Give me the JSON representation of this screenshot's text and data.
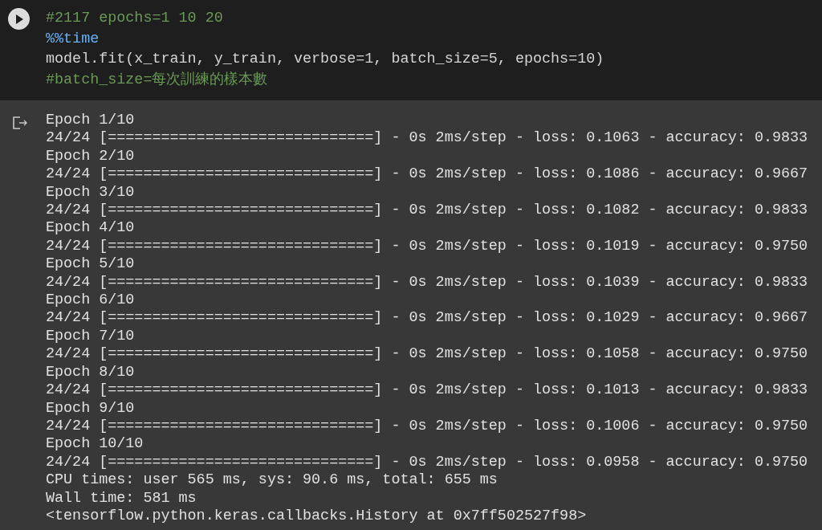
{
  "code_cell": {
    "code_lines": [
      {
        "kind": "comment",
        "text": "#2117 epochs=1 10 20"
      },
      {
        "kind": "magic",
        "text": "%%time"
      },
      {
        "kind": "code",
        "text": "model.fit(x_train, y_train, verbose=1, batch_size=5, epochs=10)"
      },
      {
        "kind": "comment",
        "text": "#batch_size=每次訓練的樣本數"
      }
    ]
  },
  "output": {
    "lines": [
      "Epoch 1/10",
      "24/24 [==============================] - 0s 2ms/step - loss: 0.1063 - accuracy: 0.9833",
      "Epoch 2/10",
      "24/24 [==============================] - 0s 2ms/step - loss: 0.1086 - accuracy: 0.9667",
      "Epoch 3/10",
      "24/24 [==============================] - 0s 2ms/step - loss: 0.1082 - accuracy: 0.9833",
      "Epoch 4/10",
      "24/24 [==============================] - 0s 2ms/step - loss: 0.1019 - accuracy: 0.9750",
      "Epoch 5/10",
      "24/24 [==============================] - 0s 2ms/step - loss: 0.1039 - accuracy: 0.9833",
      "Epoch 6/10",
      "24/24 [==============================] - 0s 2ms/step - loss: 0.1029 - accuracy: 0.9667",
      "Epoch 7/10",
      "24/24 [==============================] - 0s 2ms/step - loss: 0.1058 - accuracy: 0.9750",
      "Epoch 8/10",
      "24/24 [==============================] - 0s 2ms/step - loss: 0.1013 - accuracy: 0.9833",
      "Epoch 9/10",
      "24/24 [==============================] - 0s 2ms/step - loss: 0.1006 - accuracy: 0.9750",
      "Epoch 10/10",
      "24/24 [==============================] - 0s 2ms/step - loss: 0.0958 - accuracy: 0.9750",
      "CPU times: user 565 ms, sys: 90.6 ms, total: 655 ms",
      "Wall time: 581 ms",
      "<tensorflow.python.keras.callbacks.History at 0x7ff502527f98>"
    ]
  }
}
